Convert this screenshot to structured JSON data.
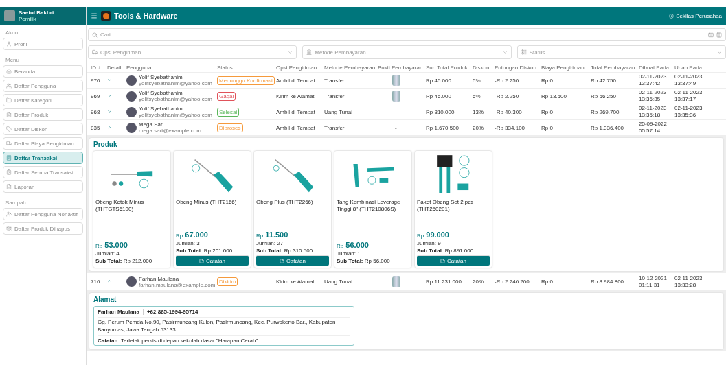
{
  "sidebar": {
    "user": {
      "name": "Saeful Bakhri",
      "role": "Pemilik"
    },
    "sections": [
      {
        "title": "Akun",
        "items": [
          {
            "label": "Profil",
            "selected": false
          }
        ]
      },
      {
        "title": "Menu",
        "items": [
          {
            "label": "Beranda",
            "selected": false
          },
          {
            "label": "Daftar Pengguna",
            "selected": false
          },
          {
            "label": "Daftar Kategori",
            "selected": false
          },
          {
            "label": "Daftar Produk",
            "selected": false
          },
          {
            "label": "Daftar Diskon",
            "selected": false
          },
          {
            "label": "Daftar Biaya Pengiriman",
            "selected": false
          },
          {
            "label": "Daftar Transaksi",
            "selected": true
          },
          {
            "label": "Daftar Semua Transaksi",
            "selected": false
          },
          {
            "label": "Laporan",
            "selected": false
          }
        ]
      },
      {
        "title": "Sampah",
        "items": [
          {
            "label": "Daftar Pengguna Nonaktif",
            "selected": false
          },
          {
            "label": "Daftar Produk Dihapus",
            "selected": false
          }
        ]
      }
    ]
  },
  "header": {
    "title": "Tools & Hardware",
    "link": "Sekilas Perusahaa"
  },
  "search": {
    "placeholder": "Cari"
  },
  "filters": [
    {
      "placeholder": "Opsi Pengiriman"
    },
    {
      "placeholder": "Metode Pembayaran"
    },
    {
      "placeholder": "Status"
    }
  ],
  "table": {
    "columns": [
      "ID ↓",
      "Detail",
      "Pengguna",
      "Status",
      "Opsi Pengiriman",
      "Metode Pembayaran",
      "Bukti Pembayaran",
      "Sub Total Produk",
      "Diskon",
      "Potongan Diskon",
      "Biaya Pengiriman",
      "Total Pembayaran",
      "Dibuat Pada",
      "Ubah Pada"
    ],
    "rows": [
      {
        "id": "970",
        "expanded": false,
        "user": {
          "name": "Yolif Syebathanim",
          "email": "yolifsyebathanim@yahoo.com"
        },
        "status": {
          "label": "Menunggu Konfirmasi",
          "color": "#f59a3c"
        },
        "shipping": "Ambil di Tempat",
        "payment": "Transfer",
        "proof": {
          "kind": "image"
        },
        "subtotal": "Rp 45.000",
        "discount": "5%",
        "cut": "-Rp 2.250",
        "fee": "Rp 0",
        "total": "Rp 42.750",
        "created": [
          "02-11-2023",
          "13:37:42"
        ],
        "updated": [
          "02-11-2023",
          "13:37:49"
        ]
      },
      {
        "id": "969",
        "expanded": false,
        "user": {
          "name": "Yolif Syebathanim",
          "email": "yolifsyebathanim@yahoo.com"
        },
        "status": {
          "label": "Gagal",
          "color": "#e0525a"
        },
        "shipping": "Kirim ke Alamat",
        "payment": "Transfer",
        "proof": {
          "kind": "image"
        },
        "subtotal": "Rp 45.000",
        "discount": "5%",
        "cut": "-Rp 2.250",
        "fee": "Rp 13.500",
        "total": "Rp 56.250",
        "created": [
          "02-11-2023",
          "13:36:35"
        ],
        "updated": [
          "02-11-2023",
          "13:37:17"
        ]
      },
      {
        "id": "968",
        "expanded": false,
        "user": {
          "name": "Yolif Syebathanim",
          "email": "yolifsyebathanim@yahoo.com"
        },
        "status": {
          "label": "Selesai",
          "color": "#5cb85c"
        },
        "shipping": "Ambil di Tempat",
        "payment": "Uang Tunai",
        "proof": {
          "kind": "text",
          "text": "-"
        },
        "subtotal": "Rp 310.000",
        "discount": "13%",
        "cut": "-Rp 40.300",
        "fee": "Rp 0",
        "total": "Rp 269.700",
        "created": [
          "02-11-2023",
          "13:35:18"
        ],
        "updated": [
          "02-11-2023",
          "13:35:36"
        ]
      },
      {
        "id": "835",
        "expanded": true,
        "user": {
          "name": "Mega Sari",
          "email": "mega.sari@example.com"
        },
        "status": {
          "label": "Diproses",
          "color": "#f59a3c"
        },
        "shipping": "Ambil di Tempat",
        "payment": "Transfer",
        "proof": {
          "kind": "text",
          "text": "-"
        },
        "subtotal": "Rp 1.670.500",
        "discount": "20%",
        "cut": "-Rp 334.100",
        "fee": "Rp 0",
        "total": "Rp 1.336.400",
        "created": [
          "25-09-2022",
          "05:57:14"
        ],
        "updated": [
          "-"
        ],
        "detail": {
          "kind": "products",
          "title": "Produk",
          "items": [
            {
              "name": "Obeng Ketok Minus (THTGTS6100)",
              "price_prefix": "Rp",
              "price": "53.000",
              "qty_label": "Jumlah:",
              "qty": "4",
              "sub_label": "Sub Total:",
              "sub": "Rp 212.000"
            },
            {
              "name": "Obeng Minus (THT2166)",
              "price_prefix": "Rp",
              "price": "67.000",
              "qty_label": "Jumlah:",
              "qty": "3",
              "sub_label": "Sub Total:",
              "sub": "Rp 201.000",
              "note": "Catatan"
            },
            {
              "name": "Obeng Plus (THT2266)",
              "price_prefix": "Rp",
              "price": "11.500",
              "qty_label": "Jumlah:",
              "qty": "27",
              "sub_label": "Sub Total:",
              "sub": "Rp 310.500",
              "note": "Catatan"
            },
            {
              "name": "Tang Kombinasi Leverage Tinggi 8\" (THT210806S)",
              "price_prefix": "Rp",
              "price": "56.000",
              "qty_label": "Jumlah:",
              "qty": "1",
              "sub_label": "Sub Total:",
              "sub": "Rp 56.000"
            },
            {
              "name": "Paket Obeng Set 2 pcs (THT250201)",
              "price_prefix": "Rp",
              "price": "99.000",
              "qty_label": "Jumlah:",
              "qty": "9",
              "sub_label": "Sub Total:",
              "sub": "Rp 891.000",
              "note": "Catatan"
            }
          ]
        }
      },
      {
        "id": "716",
        "expanded": true,
        "user": {
          "name": "Farhan Maulana",
          "email": "farhan.maulana@example.com"
        },
        "status": {
          "label": "Dikirim",
          "color": "#f59a3c"
        },
        "shipping": "Kirim ke Alamat",
        "payment": "Uang Tunai",
        "proof": {
          "kind": "image"
        },
        "subtotal": "Rp 11.231.000",
        "discount": "20%",
        "cut": "-Rp 2.246.200",
        "fee": "Rp 0",
        "total": "Rp 8.984.800",
        "created": [
          "10-12-2021",
          "01:11:31"
        ],
        "updated": [
          "02-11-2023",
          "13:33:28"
        ],
        "detail": {
          "kind": "address",
          "title": "Alamat",
          "name": "Farhan Maulana",
          "phone": "+62 885-1994-95714",
          "address": "Gg. Perum Pemda No.90, Pasirmuncang Kulon, Pasirmuncang, Kec. Purwokerto Bar., Kabupaten Banyumas, Jawa Tengah 53133.",
          "note": "**Catatan:** Terletak persis di depan sekolah dasar \"Harapan Cerah\"."
        }
      }
    ]
  }
}
